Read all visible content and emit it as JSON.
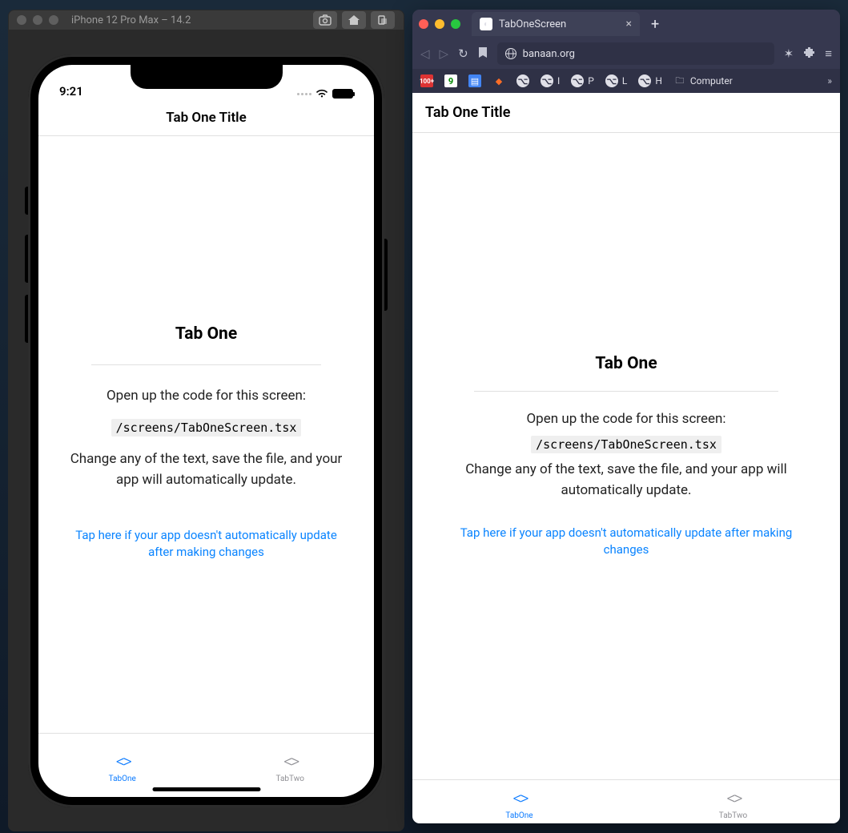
{
  "simulator": {
    "window_title": "iPhone 12 Pro Max – 14.2",
    "status_time": "9:21",
    "header_title": "Tab One Title",
    "content": {
      "heading": "Tab One",
      "instruction_line1": "Open up the code for this screen:",
      "file_path": "/screens/TabOneScreen.tsx",
      "instruction_line2": "Change any of the text, save the file, and your app will automatically update.",
      "help_link": "Tap here if your app doesn't automatically update after making changes"
    },
    "tabs": {
      "tab1": "TabOne",
      "tab2": "TabTwo"
    }
  },
  "browser": {
    "tab_title": "TabOneScreen",
    "address": "banaan.org",
    "bookmarks": {
      "computer": "Computer",
      "gh_i": "I",
      "gh_p": "P",
      "gh_l": "L",
      "gh_h": "H"
    },
    "page": {
      "header_title": "Tab One Title",
      "heading": "Tab One",
      "instruction_line1": "Open up the code for this screen:",
      "file_path": "/screens/TabOneScreen.tsx",
      "instruction_line2": "Change any of the text, save the file, and your app will automatically update.",
      "help_link": "Tap here if your app doesn't automatically update after making changes",
      "tabs": {
        "tab1": "TabOne",
        "tab2": "TabTwo"
      }
    }
  }
}
